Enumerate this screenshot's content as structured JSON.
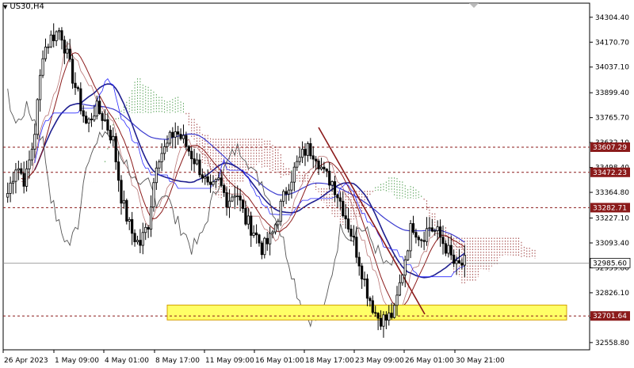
{
  "chart": {
    "symbol_label": "US30,H4",
    "bg_color": "#ffffff",
    "up_color": "#000000",
    "down_color": "#000000"
  },
  "chart_data": {
    "type": "candlestick",
    "symbol": "US30",
    "timeframe": "H4",
    "ylim": [
      32520,
      34380
    ],
    "y_ticks": [
      34304.4,
      34170.7,
      34037.1,
      33899.4,
      33765.7,
      33632.1,
      33498.4,
      33364.8,
      33227.1,
      33093.4,
      32959.8,
      32826.1,
      32692.5,
      32558.8
    ],
    "x_ticks": [
      "26 Apr 2023",
      "1 May 09:00",
      "4 May 01:00",
      "8 May 17:00",
      "11 May 09:00",
      "16 May 01:00",
      "18 May 17:00",
      "23 May 09:00",
      "26 May 01:00",
      "30 May 21:00"
    ],
    "current_price": 32985.6,
    "horizontal_levels": [
      {
        "price": 33607.29,
        "label": "33607.29",
        "color": "#8b1a1a"
      },
      {
        "price": 33472.23,
        "label": "33472.23",
        "color": "#8b1a1a"
      },
      {
        "price": 33282.71,
        "label": "33282.71",
        "color": "#8b1a1a"
      },
      {
        "price": 32701.64,
        "label": "32701.64",
        "color": "#8b1a1a"
      }
    ],
    "support_zone": {
      "from": 32680,
      "to": 32760,
      "color": "#ffff66"
    },
    "close_path": [
      33360,
      33520,
      33420,
      33660,
      34120,
      34200,
      34240,
      34050,
      33880,
      33720,
      33820,
      33760,
      33640,
      33320,
      33160,
      33080,
      33200,
      33560,
      33600,
      33700,
      33640,
      33560,
      33480,
      33360,
      33420,
      33320,
      33380,
      33220,
      33160,
      33060,
      33120,
      33280,
      33420,
      33520,
      33600,
      33580,
      33460,
      33420,
      33300,
      33160,
      33000,
      32820,
      32700,
      32680,
      32720,
      32960,
      33200,
      33120,
      33180,
      33140,
      33060,
      32960,
      32985.6
    ]
  },
  "colors": {
    "support_zone_fill": "#ffff66",
    "support_zone_stroke": "#d4a000",
    "ma_fast": "#8b1a1a",
    "ma_mid": "#1f1f8f",
    "ma_slow": "#3b3bcf",
    "kijun": "#2a2aff",
    "chikou": "#555555",
    "kumo_bull": "#2e8b2e",
    "kumo_bear": "#8b1a1a",
    "level_line": "#8b1a1a",
    "current_line": "#888888",
    "trendline": "#8b1a1a"
  }
}
